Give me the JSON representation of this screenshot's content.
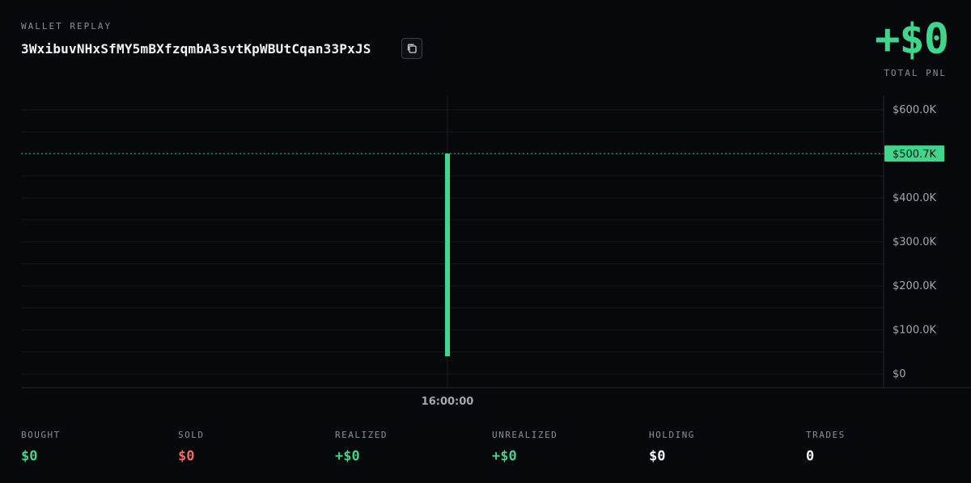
{
  "header": {
    "label": "WALLET REPLAY",
    "address": "3WxibuvNHxSfMY5mBXfzqmbA3svtKpWBUtCqan33PxJS"
  },
  "total_pnl": {
    "value": "+$0",
    "label": "TOTAL PNL"
  },
  "colors": {
    "accent": "#3ed68c",
    "negative": "#f06a6a",
    "neutral": "#f2f3f5"
  },
  "chart_data": {
    "type": "bar",
    "x_labels": [
      "16:00:00"
    ],
    "y_ticks": [
      "$600.0K",
      "$500.7K",
      "$400.0K",
      "$300.0K",
      "$200.0K",
      "$100.0K",
      "$0"
    ],
    "y_tick_values": [
      600,
      400,
      300,
      200,
      100,
      0
    ],
    "ylim": [
      0,
      600
    ],
    "bars": [
      {
        "x": "16:00:00",
        "low": 0,
        "high": 500.7
      }
    ],
    "current_value": 500.7,
    "current_label": "$500.7K",
    "grid": true
  },
  "stats": [
    {
      "label": "BOUGHT",
      "value": "$0",
      "color": "#3ed68c"
    },
    {
      "label": "SOLD",
      "value": "$0",
      "color": "#f06a6a"
    },
    {
      "label": "REALIZED",
      "value": "+$0",
      "color": "#3ed68c"
    },
    {
      "label": "UNREALIZED",
      "value": "+$0",
      "color": "#3ed68c"
    },
    {
      "label": "HOLDING",
      "value": "$0",
      "color": "#f2f3f5"
    },
    {
      "label": "TRADES",
      "value": "0",
      "color": "#f2f3f5"
    }
  ]
}
